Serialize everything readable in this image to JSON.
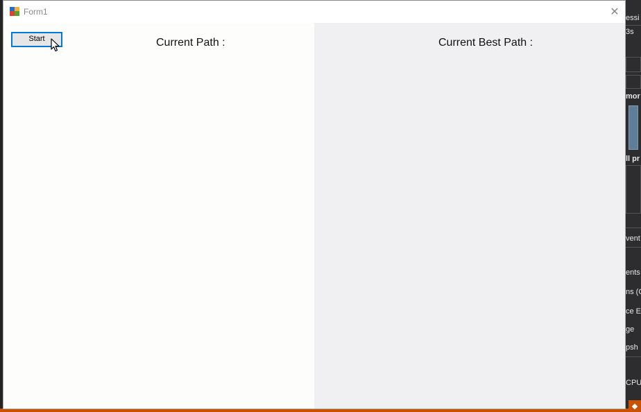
{
  "window": {
    "title": "Form1",
    "close_glyph": "✕"
  },
  "buttons": {
    "start_label": "Start"
  },
  "labels": {
    "current_path": "Current Path :",
    "current_best_path": "Current Best Path :"
  },
  "background": {
    "fragments": [
      "essi",
      "3s",
      "mor",
      "ll pr",
      "vent",
      "ents",
      "ns (C",
      "ce E",
      "ge",
      "psh",
      "CPU"
    ]
  },
  "colors": {
    "accent": "#0078d7",
    "status_bar": "#ca5100",
    "right_panel": "#f0f0f2",
    "left_panel": "#fdfdfc"
  },
  "icons": {
    "app": "winforms-app-icon",
    "close": "close-icon",
    "cursor": "mouse-pointer-icon",
    "git": "git-icon"
  }
}
